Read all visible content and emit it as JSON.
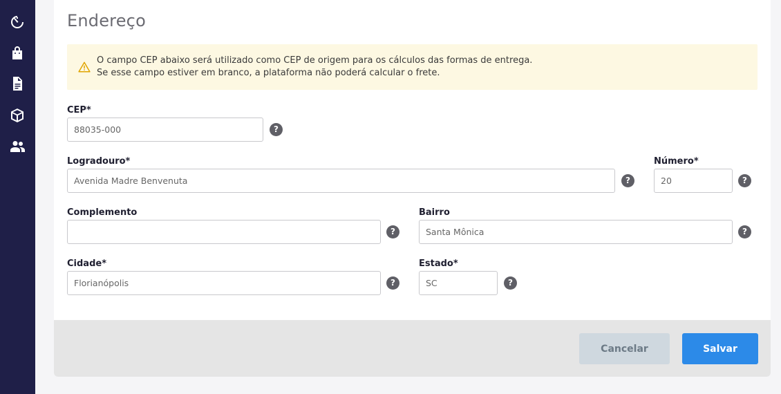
{
  "sidebar": {
    "items": [
      {
        "icon": "timer-icon"
      },
      {
        "icon": "shopping-bag-icon"
      },
      {
        "icon": "document-icon"
      },
      {
        "icon": "box-icon"
      },
      {
        "icon": "users-icon"
      }
    ]
  },
  "section": {
    "title": "Endereço"
  },
  "alert": {
    "icon": "warning-icon",
    "line1": "O campo CEP abaixo será utilizado como CEP de origem para os cálculos das formas de entrega.",
    "line2": "Se esse campo estiver em branco, a plataforma não poderá calcular o frete."
  },
  "form": {
    "cep": {
      "label": "CEP*",
      "value": "88035-000"
    },
    "logradouro": {
      "label": "Logradouro*",
      "value": "Avenida Madre Benvenuta"
    },
    "numero": {
      "label": "Número*",
      "value": "20"
    },
    "complemento": {
      "label": "Complemento",
      "value": ""
    },
    "bairro": {
      "label": "Bairro",
      "value": "Santa Mônica"
    },
    "cidade": {
      "label": "Cidade*",
      "value": "Florianópolis"
    },
    "estado": {
      "label": "Estado*",
      "value": "SC"
    },
    "help_symbol": "?"
  },
  "actions": {
    "cancel_label": "Cancelar",
    "save_label": "Salvar"
  },
  "colors": {
    "sidebar": "#1f1f48",
    "primary": "#2c8ae8",
    "alert_bg": "#fdf8e2",
    "warning": "#e0a400"
  }
}
